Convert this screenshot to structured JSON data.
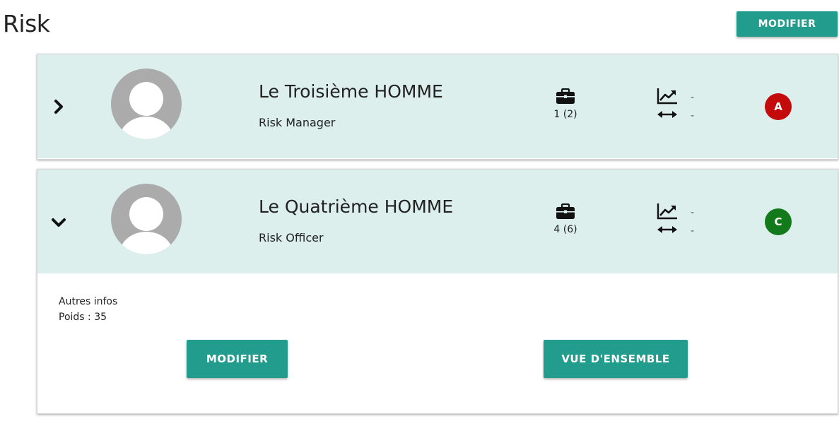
{
  "page": {
    "title": "Risk",
    "modify_label": "MODIFIER"
  },
  "cards": [
    {
      "name": "Le Troisième HOMME",
      "role": "Risk Manager",
      "count": "1 (2)",
      "trend_value": "-",
      "arrows_value": "-",
      "grade": "A",
      "grade_color": "#c40a0a",
      "expanded": false,
      "chevron_icon": "chevron-right-icon"
    },
    {
      "name": "Le Quatrième HOMME",
      "role": "Risk Officer",
      "count": "4 (6)",
      "trend_value": "-",
      "arrows_value": "-",
      "grade": "C",
      "grade_color": "#137a1c",
      "expanded": true,
      "chevron_icon": "chevron-down-icon",
      "details": {
        "other_info": "Autres infos",
        "weight": "Poids : 35",
        "modify_label": "MODIFIER",
        "overview_label": "VUE D'ENSEMBLE"
      }
    }
  ],
  "colors": {
    "accent": "#229c8c",
    "header_bg": "#dcefed"
  }
}
